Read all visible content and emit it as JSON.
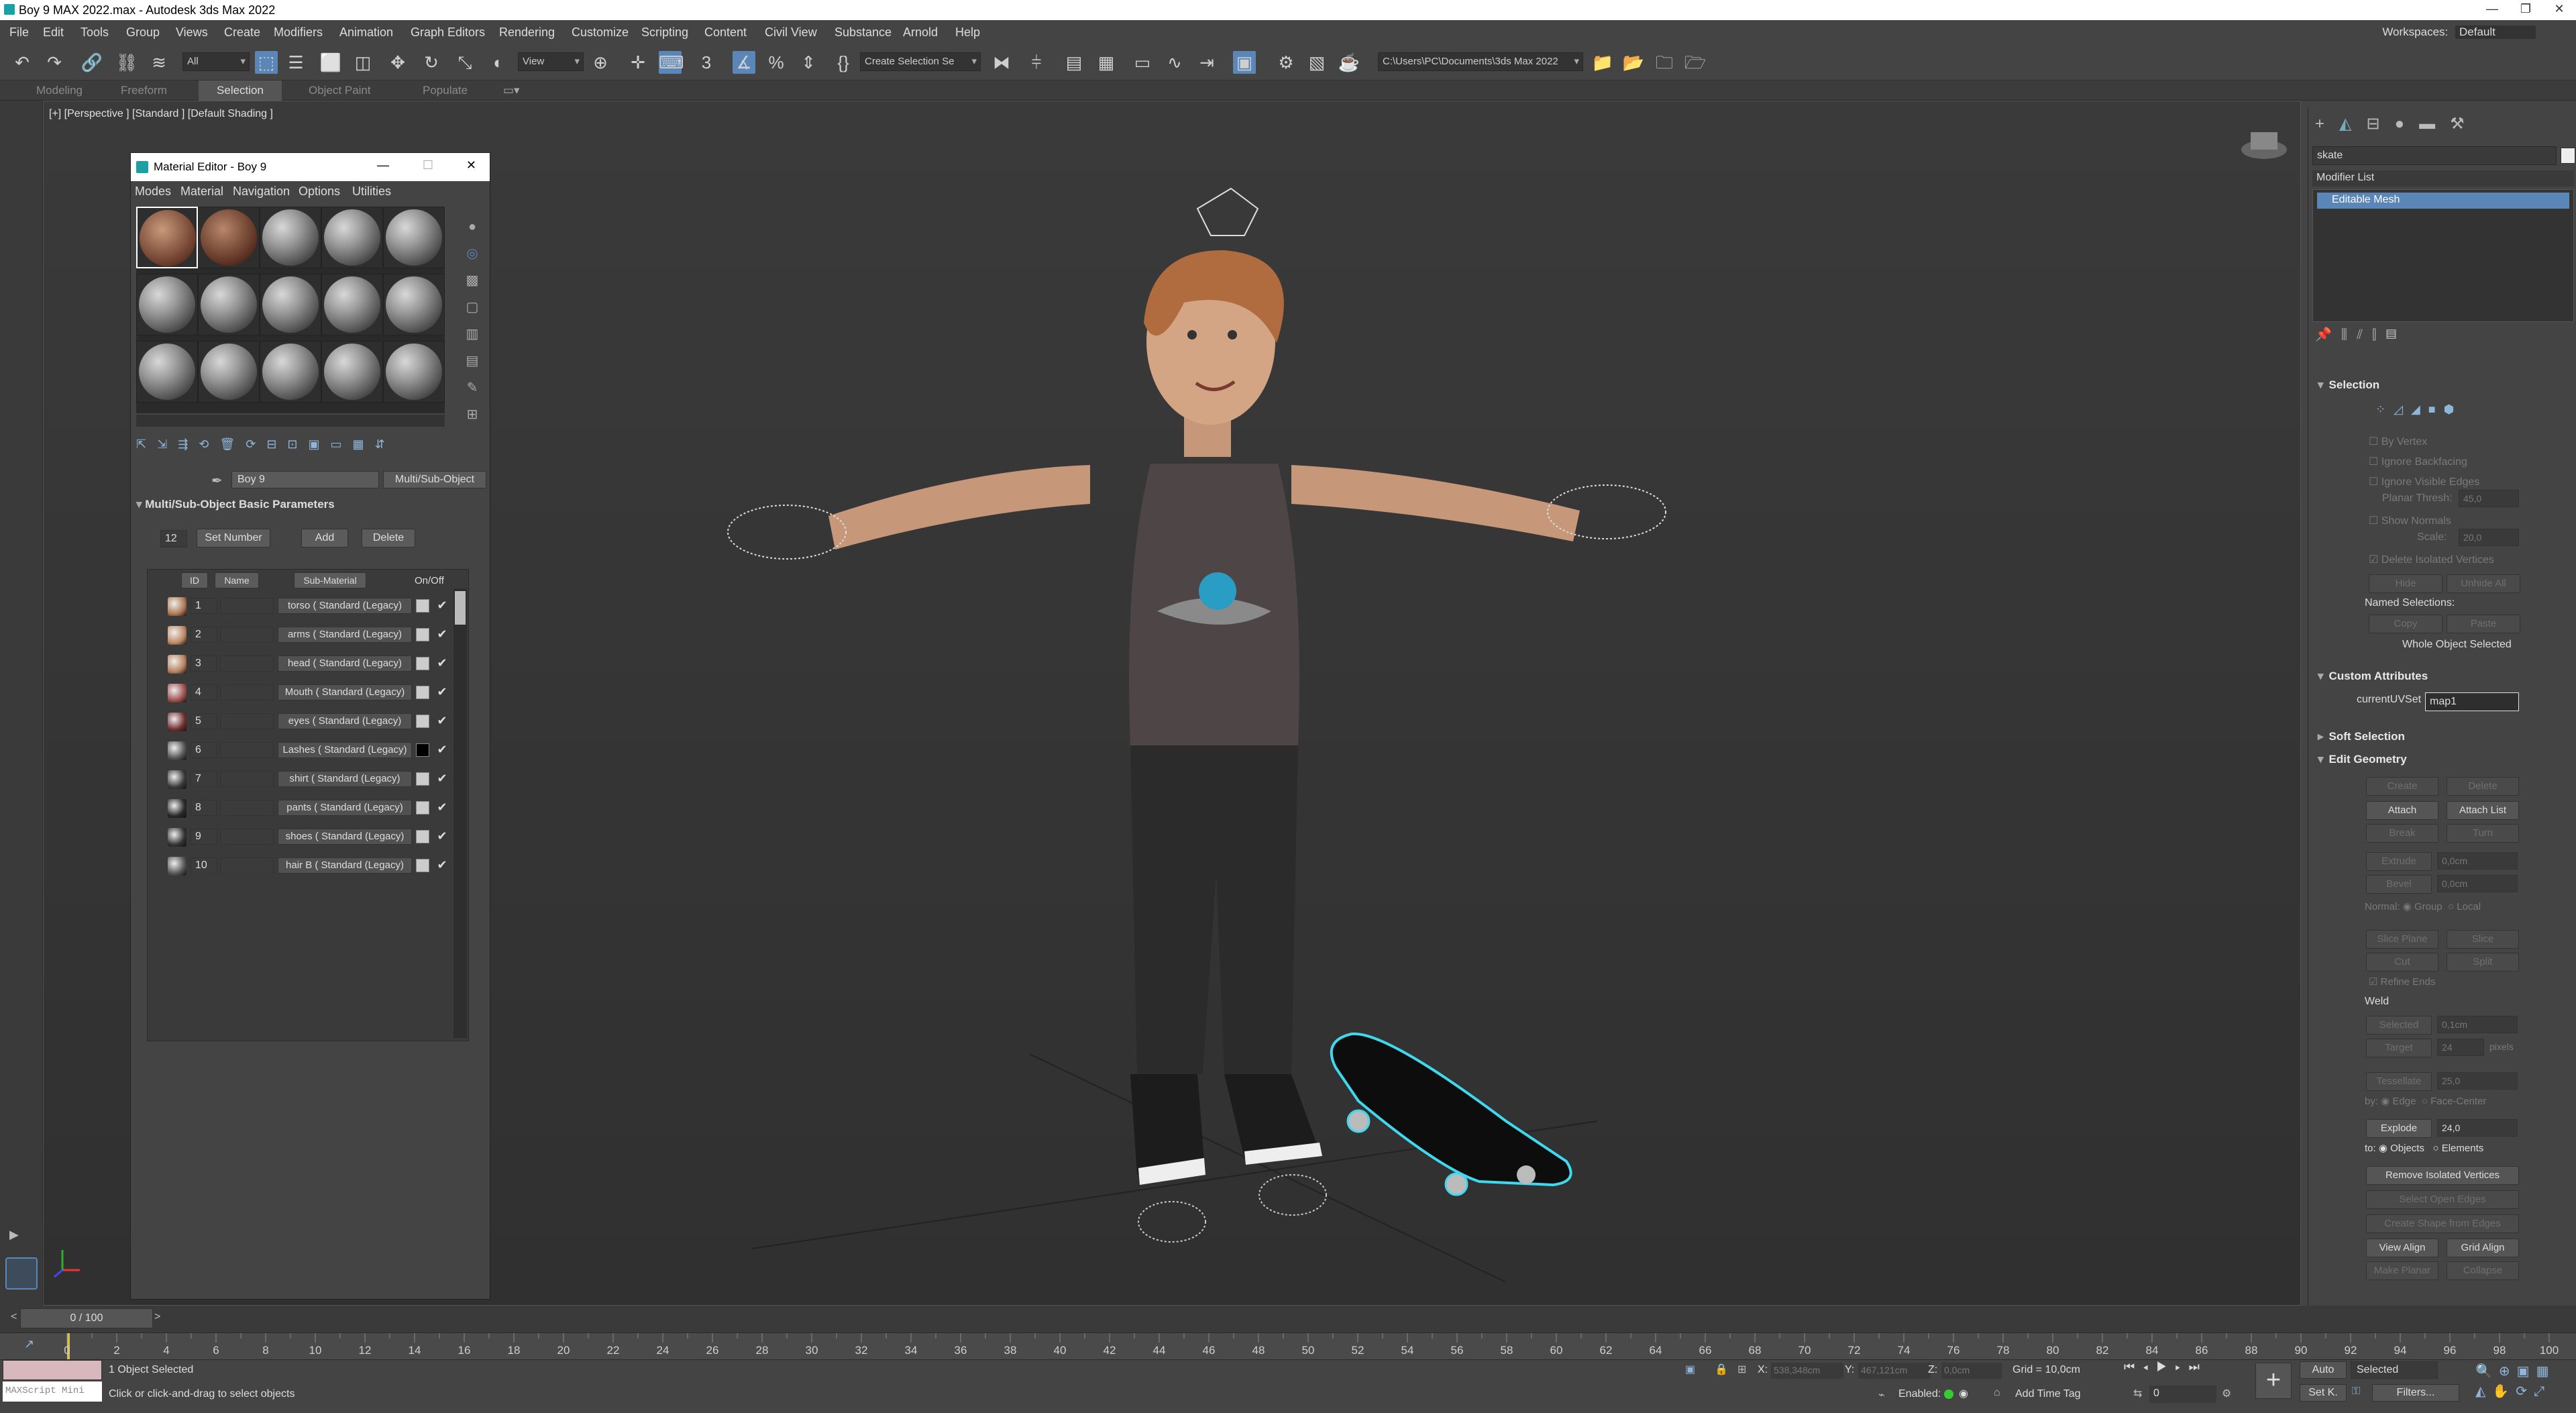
{
  "window": {
    "title": "Boy 9 MAX 2022.max - Autodesk 3ds Max 2022"
  },
  "menu": {
    "items": [
      "File",
      "Edit",
      "Tools",
      "Group",
      "Views",
      "Create",
      "Modifiers",
      "Animation",
      "Graph Editors",
      "Rendering",
      "Customize",
      "Scripting",
      "Content",
      "Civil View",
      "Substance",
      "Arnold",
      "Help"
    ],
    "workspaces_label": "Workspaces:",
    "workspaces_value": "Default"
  },
  "toolbar": {
    "selection_filter": "All",
    "ref_coord": "View",
    "selection_set": "Create Selection Se",
    "project_path": "C:\\Users\\PC\\Documents\\3ds Max 2022"
  },
  "ribbon": {
    "tabs": [
      "Modeling",
      "Freeform",
      "Selection",
      "Object Paint",
      "Populate"
    ],
    "selected": "Selection"
  },
  "viewport": {
    "label": "[+] [Perspective ] [Standard ] [Default Shading ]"
  },
  "material_editor": {
    "title": "Material Editor - Boy 9",
    "menu": [
      "Modes",
      "Material",
      "Navigation",
      "Options",
      "Utilities"
    ],
    "material_name": "Boy 9",
    "material_type": "Multi/Sub-Object",
    "rollout_title": "Multi/Sub-Object Basic Parameters",
    "count": "12",
    "buttons": {
      "set_number": "Set Number",
      "add": "Add",
      "delete": "Delete"
    },
    "columns": {
      "id": "ID",
      "name": "Name",
      "sub": "Sub-Material",
      "onoff": "On/Off"
    },
    "rows": [
      {
        "id": "1",
        "sub": "torso  ( Standard (Legacy)",
        "swatch": "#b07a55"
      },
      {
        "id": "2",
        "sub": "arms  ( Standard (Legacy)",
        "swatch": "#c08a65"
      },
      {
        "id": "3",
        "sub": "head  ( Standard (Legacy)",
        "swatch": "#b88260"
      },
      {
        "id": "4",
        "sub": "Mouth  ( Standard (Legacy)",
        "swatch": "#a05050"
      },
      {
        "id": "5",
        "sub": "eyes  ( Standard (Legacy)",
        "swatch": "#703030"
      },
      {
        "id": "6",
        "sub": "Lashes  ( Standard (Legacy)",
        "swatch": "#555555"
      },
      {
        "id": "7",
        "sub": "shirt  ( Standard (Legacy)",
        "swatch": "#3a3a3a"
      },
      {
        "id": "8",
        "sub": "pants  ( Standard (Legacy)",
        "swatch": "#2a2a2a"
      },
      {
        "id": "9",
        "sub": "shoes  ( Standard (Legacy)",
        "swatch": "#333333"
      },
      {
        "id": "10",
        "sub": "hair B  ( Standard (Legacy)",
        "swatch": "#555555"
      }
    ]
  },
  "command_panel": {
    "object_name": "skate",
    "modifier_list": "Modifier List",
    "stack_item": "Editable Mesh",
    "selection": {
      "title": "Selection",
      "by_vertex": "By Vertex",
      "ignore_backfacing": "Ignore Backfacing",
      "ignore_visible_edges": "Ignore Visible Edges",
      "planar_thresh_label": "Planar Thresh:",
      "planar_thresh": "45,0",
      "show_normals": "Show Normals",
      "scale_label": "Scale:",
      "scale": "20,0",
      "delete_isolated": "Delete Isolated Vertices",
      "hide": "Hide",
      "unhide_all": "Unhide All",
      "named_selections": "Named Selections:",
      "copy": "Copy",
      "paste": "Paste",
      "status": "Whole Object Selected"
    },
    "custom_attributes": {
      "title": "Custom Attributes",
      "label": "currentUVSet",
      "value": "map1"
    },
    "soft_selection": "Soft Selection",
    "edit_geometry": {
      "title": "Edit Geometry",
      "create": "Create",
      "delete": "Delete",
      "attach": "Attach",
      "attach_list": "Attach List",
      "break": "Break",
      "turn": "Turn",
      "extrude": "Extrude",
      "extrude_val": "0,0cm",
      "bevel": "Bevel",
      "bevel_val": "0,0cm",
      "normal": "Normal:",
      "group": "Group",
      "local": "Local",
      "slice_plane": "Slice Plane",
      "slice": "Slice",
      "cut": "Cut",
      "split": "Split",
      "refine_ends": "Refine Ends",
      "weld": "Weld",
      "selected": "Selected",
      "selected_val": "0,1cm",
      "target": "Target",
      "target_val": "24",
      "pixels": "pixels",
      "tessellate": "Tessellate",
      "tess_val": "25,0",
      "by": "by:",
      "edge": "Edge",
      "face_center": "Face-Center",
      "explode": "Explode",
      "explode_val": "24,0",
      "to": "to:",
      "objects": "Objects",
      "elements": "Elements",
      "remove_isolated": "Remove Isolated Vertices",
      "select_open_edges": "Select Open Edges",
      "create_shape": "Create Shape from Edges",
      "view_align": "View Align",
      "grid_align": "Grid Align",
      "make_planar": "Make Planar",
      "collapse": "Collapse"
    }
  },
  "timeline": {
    "frame": "0 / 100",
    "ticks": [
      "0",
      "2",
      "4",
      "6",
      "8",
      "10",
      "12",
      "14",
      "16",
      "18",
      "20",
      "22",
      "24",
      "26",
      "28",
      "30",
      "32",
      "34",
      "36",
      "38",
      "40",
      "42",
      "44",
      "46",
      "48",
      "50",
      "52",
      "54",
      "56",
      "58",
      "60",
      "62",
      "64",
      "66",
      "68",
      "70",
      "72",
      "74",
      "76",
      "78",
      "80",
      "82",
      "84",
      "86",
      "88",
      "90",
      "92",
      "94",
      "96",
      "98",
      "100"
    ]
  },
  "status": {
    "script_label": "MAXScript Mini",
    "selected": "1 Object Selected",
    "prompt": "Click or click-and-drag to select objects",
    "x_label": "X:",
    "x_value": "538,348cm",
    "y_label": "Y:",
    "y_value": "467,121cm",
    "z_label": "Z:",
    "z_value": "0,0cm",
    "grid": "Grid = 10,0cm",
    "enabled": "Enabled:",
    "add_time_tag": "Add Time Tag",
    "auto": "Auto",
    "set_key": "Set K.",
    "key_mode": "Selected",
    "filters": "Filters...",
    "frame_field": "0"
  }
}
